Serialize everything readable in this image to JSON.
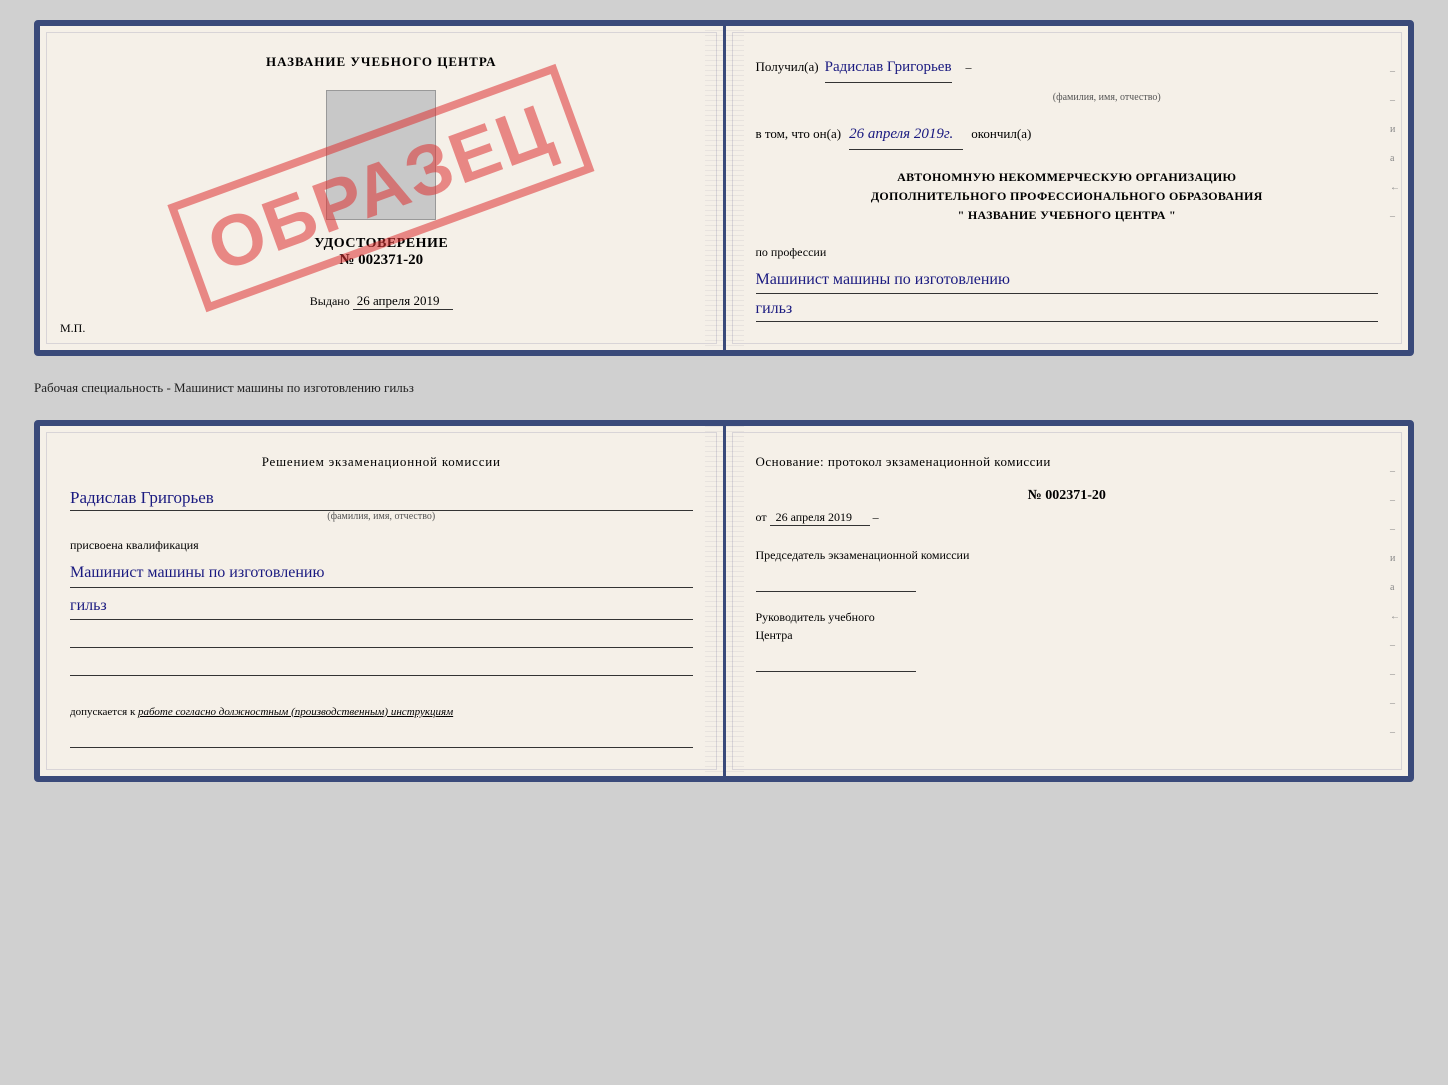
{
  "top_doc": {
    "left": {
      "center_name": "НАЗВАНИЕ УЧЕБНОГО ЦЕНТРА",
      "cert_title": "УДОСТОВЕРЕНИЕ",
      "cert_number": "№ 002371-20",
      "issued_label": "Выдано",
      "issued_date": "26 апреля 2019",
      "mp": "М.П.",
      "stamp": "ОБРАЗЕЦ"
    },
    "right": {
      "received_prefix": "Получил(а)",
      "recipient_name": "Радислав Григорьев",
      "recipient_label": "(фамилия, имя, отчество)",
      "date_prefix": "в том, что он(а)",
      "date_value": "26 апреля 2019г.",
      "date_suffix": "окончил(а)",
      "org_line1": "АВТОНОМНУЮ НЕКОММЕРЧЕСКУЮ ОРГАНИЗАЦИЮ",
      "org_line2": "ДОПОЛНИТЕЛЬНОГО ПРОФЕССИОНАЛЬНОГО ОБРАЗОВАНИЯ",
      "org_line3": "\"   НАЗВАНИЕ УЧЕБНОГО ЦЕНТРА   \"",
      "profession_label": "по профессии",
      "profession_value": "Машинист машины по изготовлению",
      "profession_value2": "гильз"
    }
  },
  "caption": "Рабочая специальность - Машинист машины по изготовлению гильз",
  "bottom_doc": {
    "left": {
      "commission_title": "Решением  экзаменационной  комиссии",
      "person_name": "Радислав Григорьев",
      "person_label": "(фамилия, имя, отчество)",
      "assigned_text": "присвоена квалификация",
      "qualification_value": "Машинист  машины  по изготовлению",
      "qualification_value2": "гильз",
      "allowed_prefix": "допускается к",
      "allowed_value": "работе согласно должностным (производственным) инструкциям"
    },
    "right": {
      "basis_title": "Основание:  протокол  экзаменационной  комиссии",
      "protocol_number": "№  002371-20",
      "protocol_date_prefix": "от",
      "protocol_date": "26 апреля 2019",
      "chair_title": "Председатель экзаменационной комиссии",
      "head_title1": "Руководитель учебного",
      "head_title2": "Центра"
    }
  }
}
